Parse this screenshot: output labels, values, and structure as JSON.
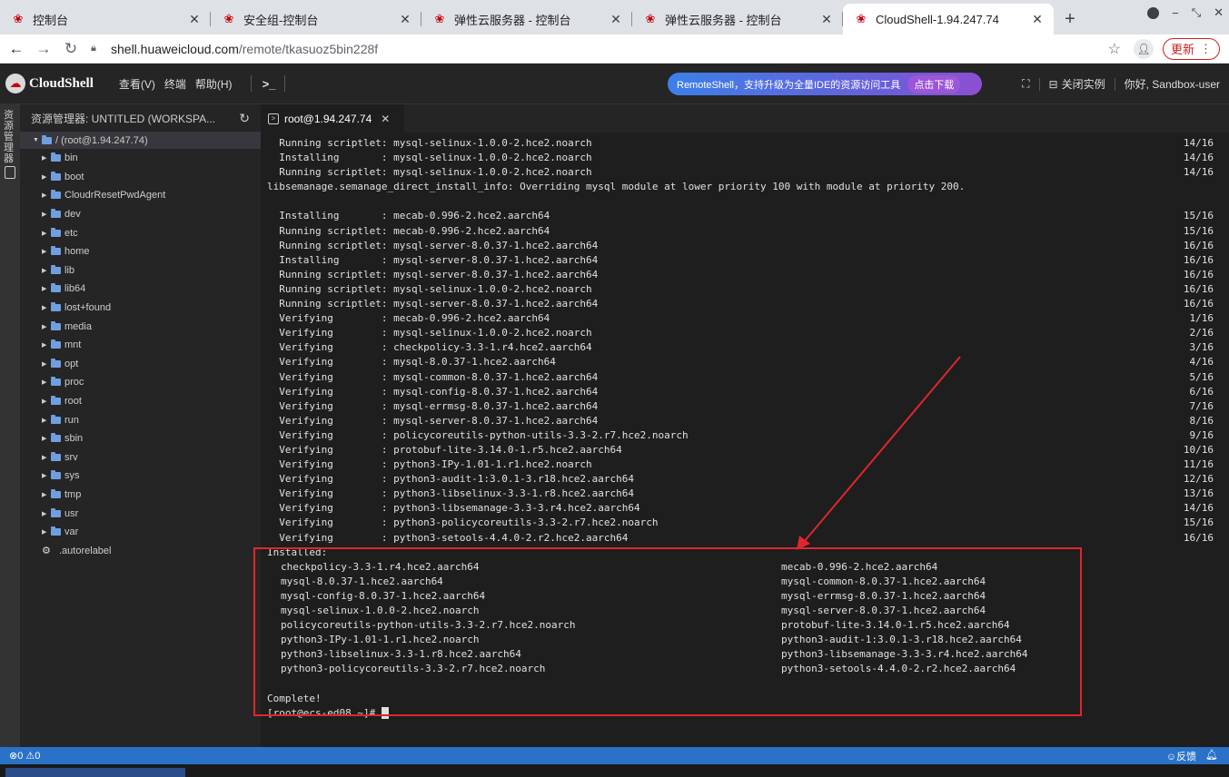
{
  "browser": {
    "tabs": [
      {
        "label": "控制台",
        "logo": "huawei-logo"
      },
      {
        "label": "安全组-控制台",
        "logo": "huawei-logo"
      },
      {
        "label": "弹性云服务器 - 控制台",
        "logo": "huawei-logo"
      },
      {
        "label": "弹性云服务器 - 控制台",
        "logo": "huawei-logo"
      },
      {
        "label": "CloudShell-1.94.247.74",
        "logo": "huawei-logo",
        "active": true
      }
    ],
    "url_host": "shell.huaweicloud.com",
    "url_path": "/remote/tkasuoz5bin228f",
    "update_label": "更新"
  },
  "header": {
    "app_name": "CloudShell",
    "menu": [
      "查看(V)",
      "终端",
      "帮助(H)"
    ],
    "promo_text": "RemoteShell，支持升级为全量IDE的资源访问工具",
    "promo_button": "点击下载",
    "close_instance": "关闭实例",
    "greeting": "你好, Sandbox-user"
  },
  "rail": {
    "label": "资源管理器"
  },
  "sidebar": {
    "title": "资源管理器: UNTITLED (WORKSPA...",
    "root": "/ (root@1.94.247.74)",
    "items": [
      "bin",
      "boot",
      "CloudrResetPwdAgent",
      "dev",
      "etc",
      "home",
      "lib",
      "lib64",
      "lost+found",
      "media",
      "mnt",
      "opt",
      "proc",
      "root",
      "run",
      "sbin",
      "srv",
      "sys",
      "tmp",
      "usr",
      "var"
    ],
    "file": ".autorelabel"
  },
  "editor": {
    "tab_label": "root@1.94.247.74"
  },
  "terminal": {
    "lines": [
      {
        "text": "  Running scriptlet: mysql-selinux-1.0.0-2.hce2.noarch",
        "count": "14/16"
      },
      {
        "text": "  Installing       : mysql-selinux-1.0.0-2.hce2.noarch",
        "count": "14/16"
      },
      {
        "text": "  Running scriptlet: mysql-selinux-1.0.0-2.hce2.noarch",
        "count": "14/16"
      },
      {
        "text": "libsemanage.semanage_direct_install_info: Overriding mysql module at lower priority 100 with module at priority 200.",
        "count": ""
      },
      {
        "text": "",
        "count": ""
      },
      {
        "text": "  Installing       : mecab-0.996-2.hce2.aarch64",
        "count": "15/16"
      },
      {
        "text": "  Running scriptlet: mecab-0.996-2.hce2.aarch64",
        "count": "15/16"
      },
      {
        "text": "  Running scriptlet: mysql-server-8.0.37-1.hce2.aarch64",
        "count": "16/16"
      },
      {
        "text": "  Installing       : mysql-server-8.0.37-1.hce2.aarch64",
        "count": "16/16"
      },
      {
        "text": "  Running scriptlet: mysql-server-8.0.37-1.hce2.aarch64",
        "count": "16/16"
      },
      {
        "text": "  Running scriptlet: mysql-selinux-1.0.0-2.hce2.noarch",
        "count": "16/16"
      },
      {
        "text": "  Running scriptlet: mysql-server-8.0.37-1.hce2.aarch64",
        "count": "16/16"
      },
      {
        "text": "  Verifying        : mecab-0.996-2.hce2.aarch64",
        "count": "1/16"
      },
      {
        "text": "  Verifying        : mysql-selinux-1.0.0-2.hce2.noarch",
        "count": "2/16"
      },
      {
        "text": "  Verifying        : checkpolicy-3.3-1.r4.hce2.aarch64",
        "count": "3/16"
      },
      {
        "text": "  Verifying        : mysql-8.0.37-1.hce2.aarch64",
        "count": "4/16"
      },
      {
        "text": "  Verifying        : mysql-common-8.0.37-1.hce2.aarch64",
        "count": "5/16"
      },
      {
        "text": "  Verifying        : mysql-config-8.0.37-1.hce2.aarch64",
        "count": "6/16"
      },
      {
        "text": "  Verifying        : mysql-errmsg-8.0.37-1.hce2.aarch64",
        "count": "7/16"
      },
      {
        "text": "  Verifying        : mysql-server-8.0.37-1.hce2.aarch64",
        "count": "8/16"
      },
      {
        "text": "  Verifying        : policycoreutils-python-utils-3.3-2.r7.hce2.noarch",
        "count": "9/16"
      },
      {
        "text": "  Verifying        : protobuf-lite-3.14.0-1.r5.hce2.aarch64",
        "count": "10/16"
      },
      {
        "text": "  Verifying        : python3-IPy-1.01-1.r1.hce2.noarch",
        "count": "11/16"
      },
      {
        "text": "  Verifying        : python3-audit-1:3.0.1-3.r18.hce2.aarch64",
        "count": "12/16"
      },
      {
        "text": "  Verifying        : python3-libselinux-3.3-1.r8.hce2.aarch64",
        "count": "13/16"
      },
      {
        "text": "  Verifying        : python3-libsemanage-3.3-3.r4.hce2.aarch64",
        "count": "14/16"
      },
      {
        "text": "  Verifying        : python3-policycoreutils-3.3-2.r7.hce2.noarch",
        "count": "15/16"
      },
      {
        "text": "  Verifying        : python3-setools-4.4.0-2.r2.hce2.aarch64",
        "count": "16/16"
      }
    ],
    "installed_header": "Installed:",
    "installed": [
      [
        "checkpolicy-3.3-1.r4.hce2.aarch64",
        "mecab-0.996-2.hce2.aarch64"
      ],
      [
        "mysql-8.0.37-1.hce2.aarch64",
        "mysql-common-8.0.37-1.hce2.aarch64"
      ],
      [
        "mysql-config-8.0.37-1.hce2.aarch64",
        "mysql-errmsg-8.0.37-1.hce2.aarch64"
      ],
      [
        "mysql-selinux-1.0.0-2.hce2.noarch",
        "mysql-server-8.0.37-1.hce2.aarch64"
      ],
      [
        "policycoreutils-python-utils-3.3-2.r7.hce2.noarch",
        "protobuf-lite-3.14.0-1.r5.hce2.aarch64"
      ],
      [
        "python3-IPy-1.01-1.r1.hce2.noarch",
        "python3-audit-1:3.0.1-3.r18.hce2.aarch64"
      ],
      [
        "python3-libselinux-3.3-1.r8.hce2.aarch64",
        "python3-libsemanage-3.3-3.r4.hce2.aarch64"
      ],
      [
        "python3-policycoreutils-3.3-2.r7.hce2.noarch",
        "python3-setools-4.4.0-2.r2.hce2.aarch64"
      ]
    ],
    "complete": "Complete!",
    "prompt": "[root@ecs-ed08 ~]# "
  },
  "statusbar": {
    "problems": "⊗0 ⚠0",
    "feedback": "☺反馈"
  },
  "colors": {
    "annotation": "#e0262b",
    "statusbar": "#2a72c8",
    "brand": "#c7000b"
  }
}
